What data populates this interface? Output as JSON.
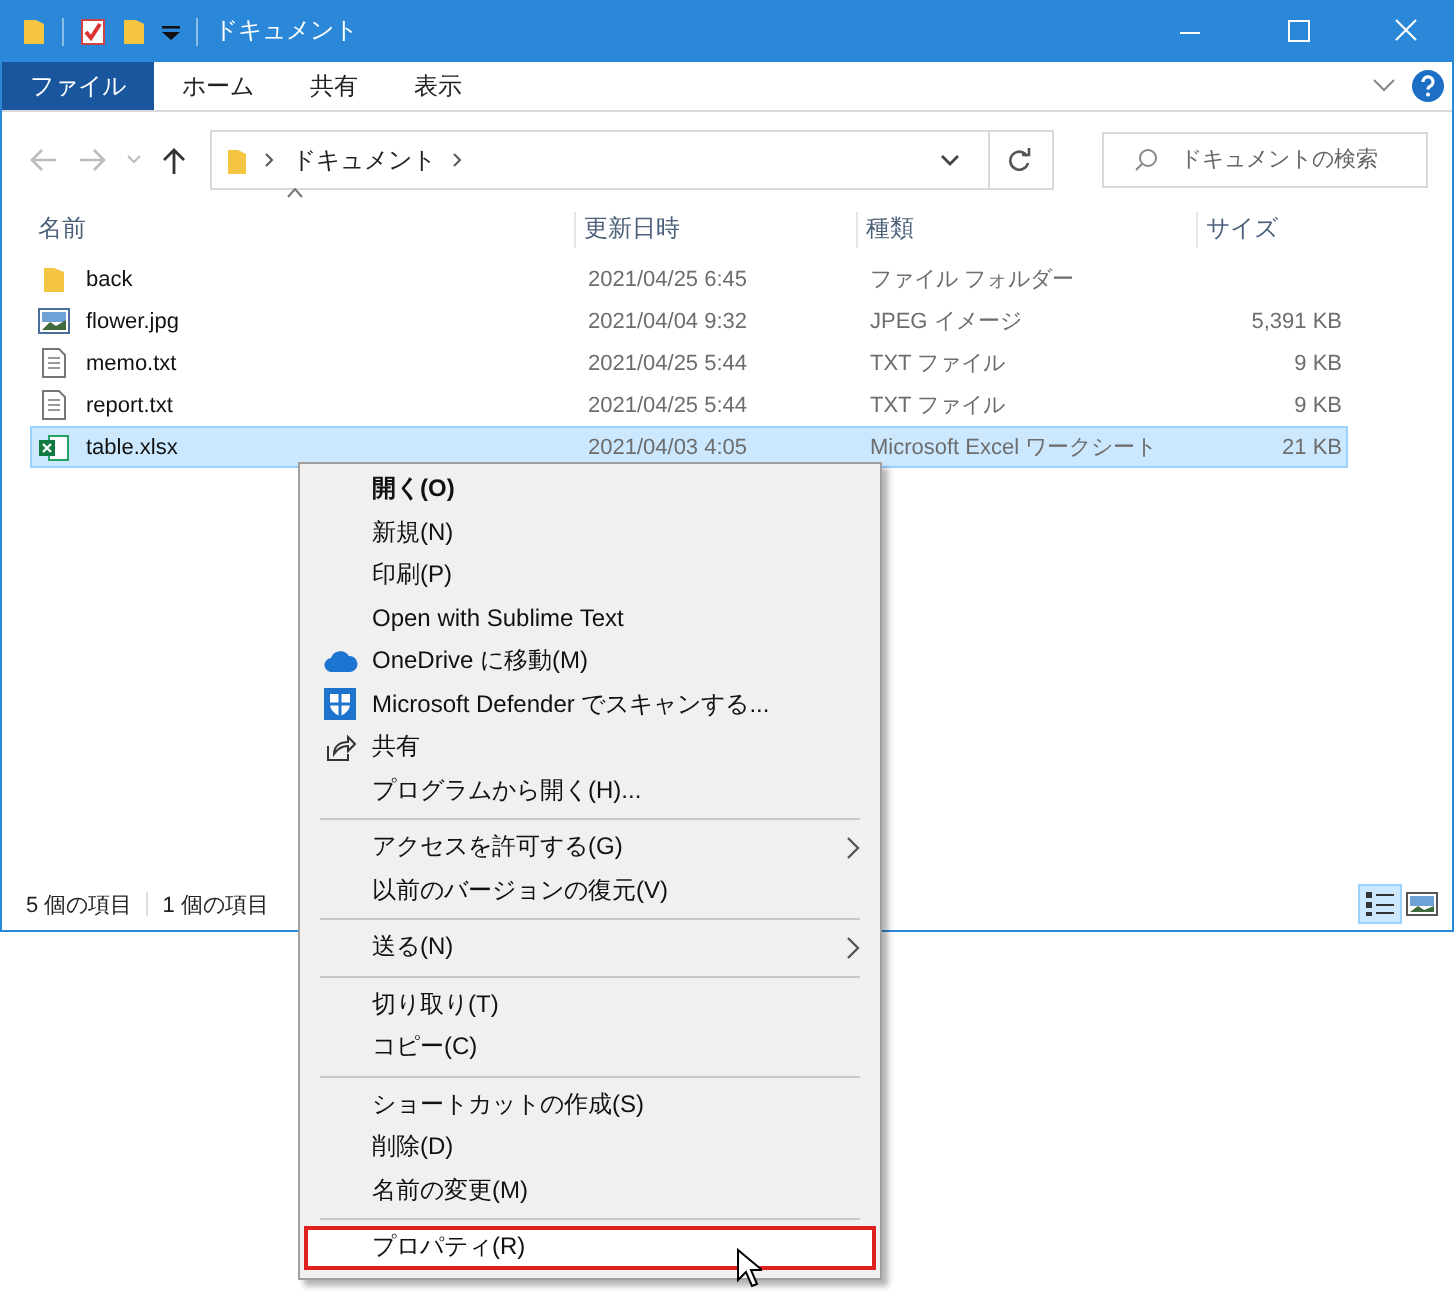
{
  "window": {
    "title": "ドキュメント"
  },
  "ribbon_tabs": [
    {
      "label": "ファイル",
      "selected": true
    },
    {
      "label": "ホーム",
      "selected": false
    },
    {
      "label": "共有",
      "selected": false
    },
    {
      "label": "表示",
      "selected": false
    }
  ],
  "address": {
    "path": "ドキュメント"
  },
  "search": {
    "placeholder": "ドキュメントの検索"
  },
  "columns": [
    "名前",
    "更新日時",
    "種類",
    "サイズ"
  ],
  "rows": [
    {
      "kind": "folder",
      "name": "back",
      "modified": "2021/04/25 6:45",
      "type": "ファイル フォルダー",
      "size": "",
      "selected": false
    },
    {
      "kind": "image",
      "name": "flower.jpg",
      "modified": "2021/04/04 9:32",
      "type": "JPEG イメージ",
      "size": "5,391 KB",
      "selected": false
    },
    {
      "kind": "text",
      "name": "memo.txt",
      "modified": "2021/04/25 5:44",
      "type": "TXT ファイル",
      "size": "9 KB",
      "selected": false
    },
    {
      "kind": "text",
      "name": "report.txt",
      "modified": "2021/04/25 5:44",
      "type": "TXT ファイル",
      "size": "9 KB",
      "selected": false
    },
    {
      "kind": "spreadsheet",
      "name": "table.xlsx",
      "modified": "2021/04/03 4:05",
      "type": "Microsoft Excel ワークシート",
      "size": "21 KB",
      "selected": true
    }
  ],
  "status_bar": {
    "count": "5 個の項目",
    "selection": "1 個の項目"
  },
  "view_buttons": [
    {
      "selected": true
    },
    {
      "selected": false
    }
  ],
  "context_menu": {
    "groups": [
      [
        {
          "label": "開く(O)",
          "default": true,
          "submenu": false,
          "selected": false
        },
        {
          "label": "新規(N)",
          "default": false,
          "submenu": false,
          "selected": false
        },
        {
          "label": "印刷(P)",
          "default": false,
          "submenu": false,
          "selected": false
        },
        {
          "label": "Open with Sublime Text",
          "default": false,
          "submenu": false,
          "selected": false
        },
        {
          "label": "OneDrive に移動(M)",
          "default": false,
          "submenu": false,
          "selected": false
        },
        {
          "label": "Microsoft Defender でスキャンする...",
          "default": false,
          "submenu": false,
          "selected": false
        },
        {
          "label": "共有",
          "default": false,
          "submenu": false,
          "selected": false
        },
        {
          "label": "プログラムから開く(H)...",
          "default": false,
          "submenu": false,
          "selected": false
        }
      ],
      [
        {
          "label": "アクセスを許可する(G)",
          "default": false,
          "submenu": true,
          "selected": false
        },
        {
          "label": "以前のバージョンの復元(V)",
          "default": false,
          "submenu": false,
          "selected": false
        }
      ],
      [
        {
          "label": "送る(N)",
          "default": false,
          "submenu": true,
          "selected": false
        }
      ],
      [
        {
          "label": "切り取り(T)",
          "default": false,
          "submenu": false,
          "selected": false
        },
        {
          "label": "コピー(C)",
          "default": false,
          "submenu": false,
          "selected": false
        }
      ],
      [
        {
          "label": "ショートカットの作成(S)",
          "default": false,
          "submenu": false,
          "selected": false
        },
        {
          "label": "削除(D)",
          "default": false,
          "submenu": false,
          "selected": false
        },
        {
          "label": "名前の変更(M)",
          "default": false,
          "submenu": false,
          "selected": false
        }
      ],
      [
        {
          "label": "プロパティ(R)",
          "default": false,
          "submenu": false,
          "selected": true
        }
      ]
    ]
  }
}
